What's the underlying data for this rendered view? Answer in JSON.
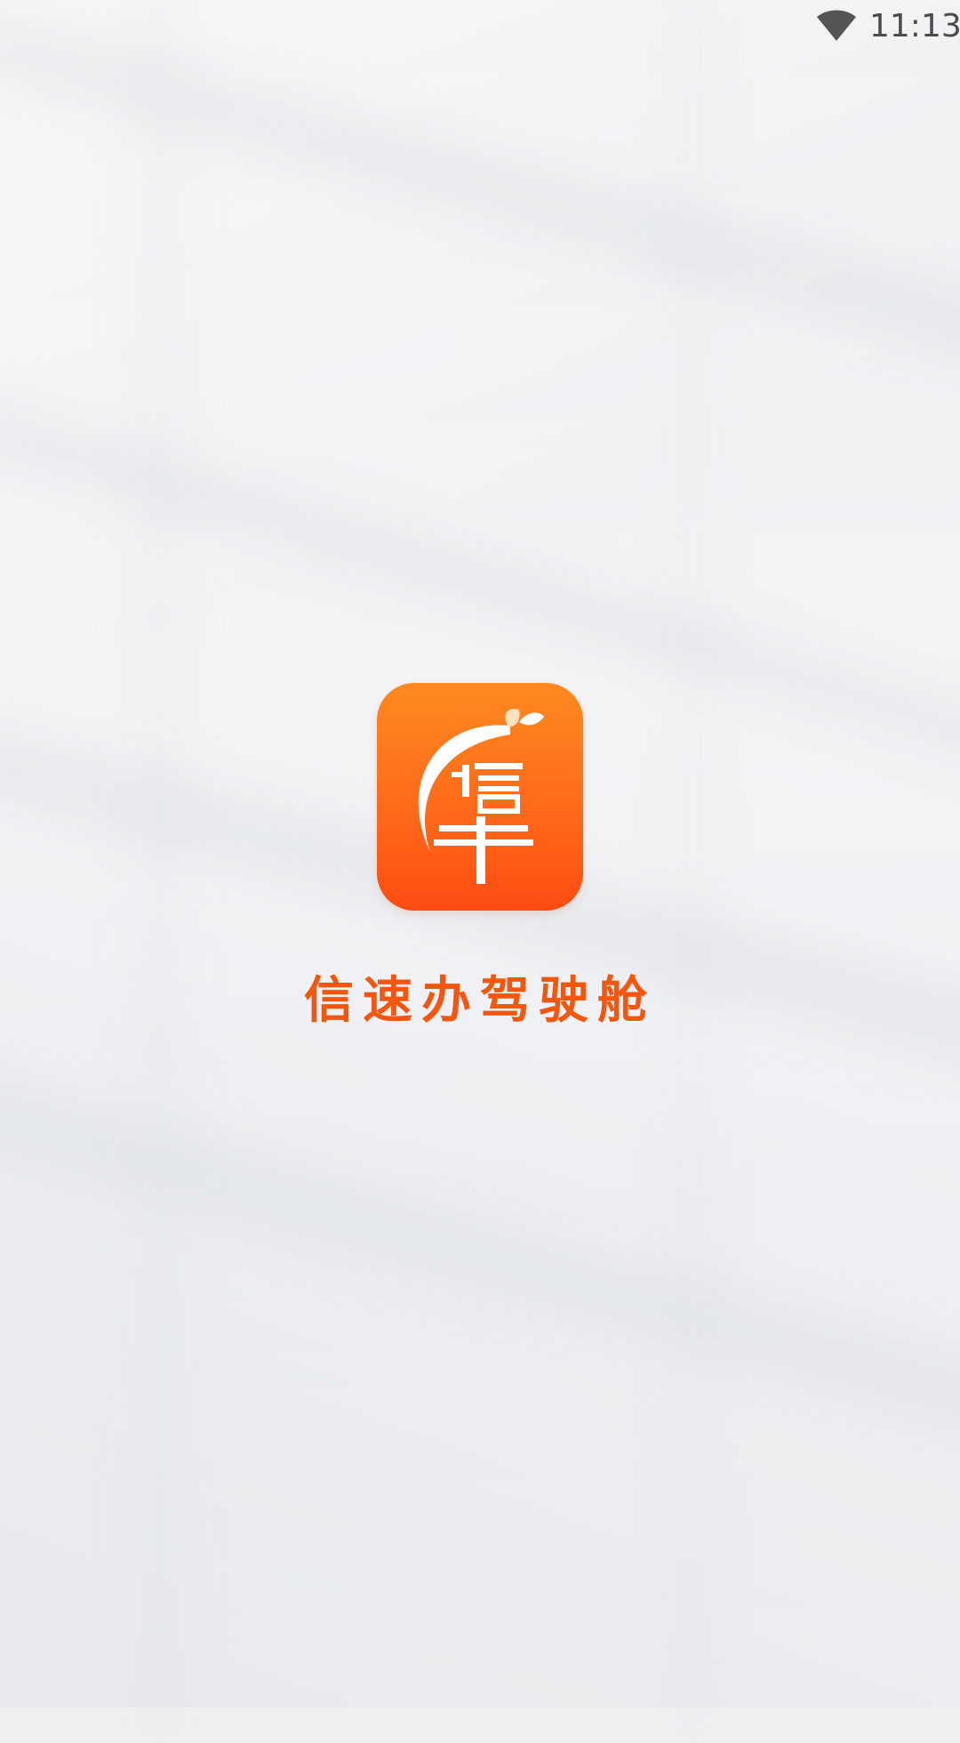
{
  "status_bar": {
    "time": "11:13",
    "icons": [
      "wifi-icon"
    ]
  },
  "splash": {
    "app_icon": "app-logo-icon",
    "app_name": "信速办驾驶舱"
  },
  "colors": {
    "brand_orange": "#f2560f",
    "icon_gradient_top": "#ff8a1f",
    "icon_gradient_bottom": "#ff4c12",
    "background": "#eef0f2"
  }
}
